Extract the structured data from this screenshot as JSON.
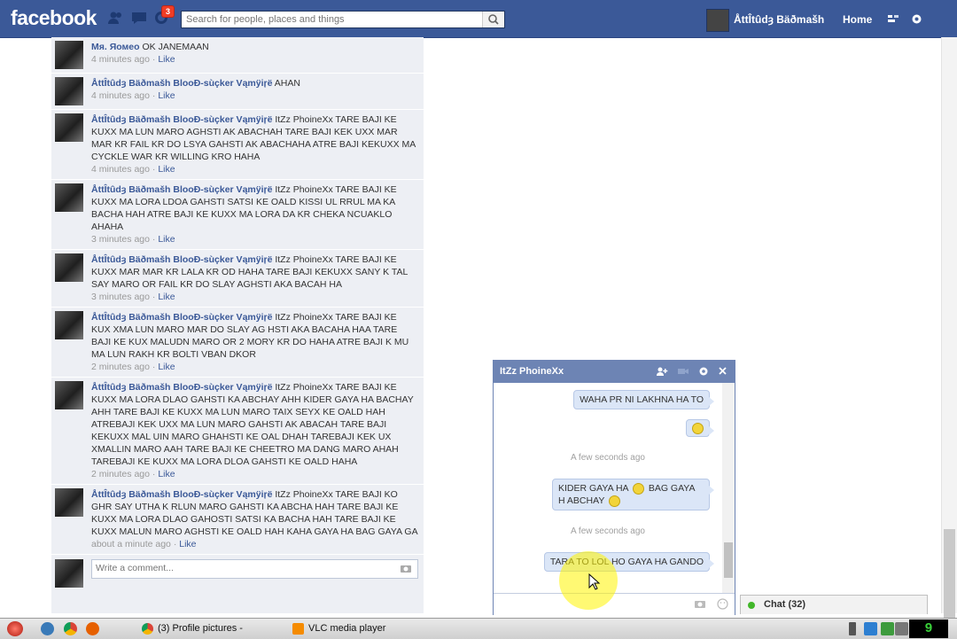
{
  "topbar": {
    "logo": "facebook",
    "notification_count": "3",
    "search_placeholder": "Search for people, places and things",
    "user_name": "ÅttÎtûdȝ Bäðmašh",
    "home_label": "Home"
  },
  "feed": {
    "comments": [
      {
        "author": "Mя. Яомео",
        "text": "OK JANEMAAN",
        "time": "4 minutes ago",
        "like": "Like"
      },
      {
        "author": "ÅttÎtûdȝ Bäðmašh BlooÐ-sùçker Vąmÿiŗë",
        "text": "AHAN",
        "time": "4 minutes ago",
        "like": "Like"
      },
      {
        "author": "ÅttÎtûdȝ Bäðmašh BlooÐ-sùçker Vąmÿiŗë",
        "text": "ItZz PhoineXx TARE BAJI KE KUXX MA LUN MARO AGHSTI AK ABACHAH TARE BAJI KEK UXX MAR MAR KR FAIL KR DO LSYA GAHSTI AK ABACHAHA ATRE BAJI KEKUXX MA CYCKLE WAR KR WILLING KRO HAHA",
        "time": "4 minutes ago",
        "like": "Like"
      },
      {
        "author": "ÅttÎtûdȝ Bäðmašh BlooÐ-sùçker Vąmÿiŗë",
        "text": "ItZz PhoineXx TARE BAJI KE KUXX MA LORA LDOA GAHSTI SATSI KE OALD KISSI UL RRUL MA KA BACHA HAH ATRE BAJI KE KUXX MA LORA DA KR CHEKA NCUAKLO AHAHA",
        "time": "3 minutes ago",
        "like": "Like"
      },
      {
        "author": "ÅttÎtûdȝ Bäðmašh BlooÐ-sùçker Vąmÿiŗë",
        "text": "ItZz PhoineXx TARE BAJI KE KUXX MAR MAR KR LALA KR OD HAHA TARE BAJI KEKUXX SANY K TAL SAY MARO OR FAIL KR DO SLAY AGHSTI AKA BACAH HA",
        "time": "3 minutes ago",
        "like": "Like"
      },
      {
        "author": "ÅttÎtûdȝ Bäðmašh BlooÐ-sùçker Vąmÿiŗë",
        "text": "ItZz PhoineXx TARE BAJI KE KUX XMA LUN MARO MAR DO SLAY AG HSTI AKA BACAHA HAA TARE BAJI KE KUX MALUDN MARO OR 2 MORY KR DO HAHA ATRE BAJI K MU MA LUN RAKH KR BOLTI VBAN DKOR",
        "time": "2 minutes ago",
        "like": "Like"
      },
      {
        "author": "ÅttÎtûdȝ Bäðmašh BlooÐ-sùçker Vąmÿiŗë",
        "text": "ItZz PhoineXx TARE BAJI KE KUXX MA LORA DLAO GAHSTI KA ABCHAY AHH KIDER GAYA HA BACHAY AHH TARE BAJI KE KUXX MA LUN MARO TAIX SEYX KE OALD HAH ATREBAJI KEK UXX MA LUN MARO GAHSTI AK ABACAH TARE BAJI KEKUXX MAL UIN MARO GHAHSTI KE OAL DHAH TAREBAJI KEK UX XMALLIN MARO AAH TARE BAJI KE CHEETRO MA DANG MARO AHAH TAREBAJI KE KUXX MA LORA DLOA GAHSTI KE OALD HAHA",
        "time": "2 minutes ago",
        "like": "Like"
      },
      {
        "author": "ÅttÎtûdȝ Bäðmašh BlooÐ-sùçker Vąmÿiŗë",
        "text": "ItZz PhoineXx TARE BAJI KO GHR SAY UTHA K RLUN MARO GAHSTI KA ABCHA HAH TARE BAJI KE KUXX MA LORA DLAO GAHOSTI SATSI KA BACHA HAH TARE BAJI KE KUXX MALUN MARO AGHSTI KE OALD HAH KAHA GAYA HA BAG GAYA GA",
        "time": "about a minute ago",
        "like": "Like"
      }
    ],
    "write_placeholder": "Write a comment..."
  },
  "chat": {
    "title": "ItZz PhoineXx",
    "messages": [
      {
        "text": "WAHA PR NI LAKHNA HA TO"
      },
      {
        "text": ""
      },
      {
        "text": "KIDER GAYA HA",
        "text2": "BAG GAYA H ABCHAY"
      },
      {
        "text": "TARA TO LOL HO GAYA HA GANDO"
      }
    ],
    "timestamps": [
      "A few seconds ago",
      "A few seconds ago"
    ]
  },
  "chat_dock": {
    "label": "Chat (32)"
  },
  "taskbar": {
    "tasks": [
      "(3) Profile pictures -",
      "VLC media player"
    ],
    "clock": "9"
  },
  "colors": {
    "brand": "#3b5998",
    "chat_header": "#6d84b4",
    "bubble": "#dbe6f7"
  },
  "icons": [
    "friend-requests-icon",
    "messages-icon",
    "notifications-icon",
    "search-icon",
    "gear-icon",
    "camera-icon",
    "close-icon",
    "add-people-icon",
    "smiley-icon"
  ]
}
